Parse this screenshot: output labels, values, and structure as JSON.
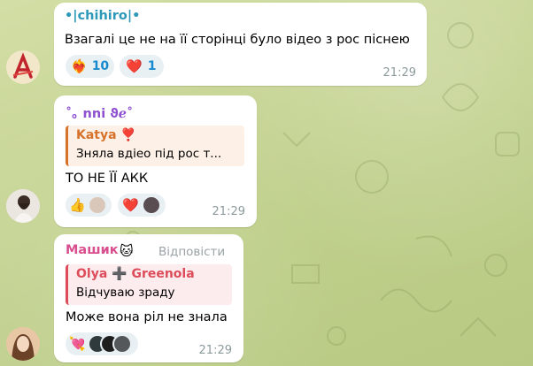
{
  "messages": [
    {
      "sender": "•|chihiro|•",
      "sender_color": "#2c99b8",
      "text": "Взагалі це не на її сторінці було відео з рос піснею",
      "time": "21:29",
      "reactions": [
        {
          "emoji": "❤️‍🔥",
          "icon": "heart-on-fire-icon",
          "count": "10"
        },
        {
          "emoji": "❤️",
          "icon": "heart-icon",
          "count": "1"
        }
      ]
    },
    {
      "sender": "˚｡ nni ϑℯ˚",
      "sender_color": "#8e4fd1",
      "reply": {
        "name": "Katya ❣️",
        "text": "Зняла вдіео під рос т...",
        "color": "#d67229"
      },
      "text": "ТО НЕ ЇЇ АКК",
      "time": "21:29",
      "reactions": [
        {
          "emoji": "👍",
          "icon": "thumbs-up-icon"
        },
        {
          "emoji": "❤️",
          "icon": "heart-icon"
        }
      ]
    },
    {
      "sender": "Машик",
      "sender_color": "#d94e8f",
      "reply_action": "Відповісти",
      "reply": {
        "name": "Olya ➕ Greenola",
        "text": "Відчуваю зраду",
        "color": "#dd4c5a"
      },
      "text": "Може вона ріл не знала",
      "time": "21:29",
      "reactions": [
        {
          "emoji": "💘",
          "icon": "heart-with-arrow-icon"
        }
      ]
    }
  ]
}
